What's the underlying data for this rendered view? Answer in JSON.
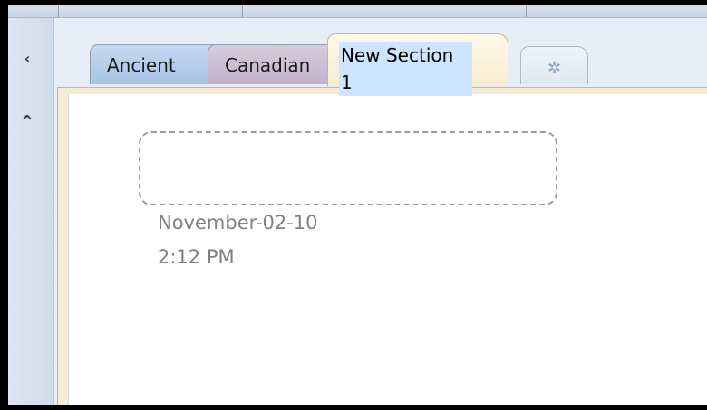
{
  "navigation": {
    "collapse_icon": "chevron-left-icon",
    "collapse_glyph": "‹",
    "scroll_up_icon": "chevron-up-icon",
    "scroll_up_glyph": "^"
  },
  "tabs": [
    {
      "label": "Ancient",
      "color": "#b7cdea"
    },
    {
      "label": "Canadian",
      "color": "#ccbcd5"
    },
    {
      "label": "New Section 1",
      "color": "#fbf1da",
      "editing": true
    }
  ],
  "new_tab": {
    "icon": "new-section-icon",
    "glyph": "✲"
  },
  "page": {
    "date": "November-02-10",
    "time": "2:12 PM"
  }
}
